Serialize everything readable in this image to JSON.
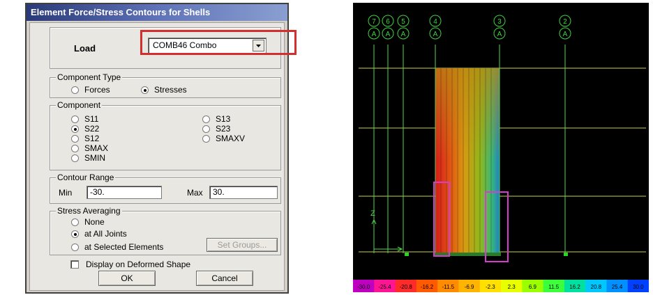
{
  "dialog": {
    "title": "Element Force/Stress Contours for Shells",
    "load": {
      "label": "Load",
      "value": "COMB46 Combo"
    },
    "component_type": {
      "label": "Component Type",
      "options": [
        "Forces",
        "Stresses"
      ],
      "selected": "Stresses"
    },
    "component": {
      "label": "Component",
      "left_options": [
        "S11",
        "S22",
        "S12",
        "SMAX",
        "SMIN"
      ],
      "right_options": [
        "S13",
        "S23",
        "SMAXV"
      ],
      "selected": "S22"
    },
    "contour_range": {
      "label": "Contour Range",
      "min_label": "Min",
      "min_value": "-30.",
      "max_label": "Max",
      "max_value": "30."
    },
    "stress_averaging": {
      "label": "Stress Averaging",
      "options": [
        "None",
        "at All Joints",
        "at Selected Elements"
      ],
      "selected": "at All Joints",
      "set_groups_label": "Set Groups..."
    },
    "display_deformed_label": "Display on Deformed Shape",
    "ok_label": "OK",
    "cancel_label": "Cancel"
  },
  "view": {
    "grid_bubbles": [
      {
        "top": "7",
        "bottom": "A"
      },
      {
        "top": "6",
        "bottom": "A"
      },
      {
        "top": "5",
        "bottom": "A"
      },
      {
        "top": "4",
        "bottom": "A"
      },
      {
        "top": "3",
        "bottom": "A"
      },
      {
        "top": "2",
        "bottom": "A"
      }
    ],
    "axis_label": "Z",
    "colors": {
      "grid_line": "#4fd84f",
      "level_line": "#c8d24a",
      "highlight": "#d83ccf",
      "bubble": "#3fd43f"
    }
  },
  "colorbar": {
    "ticks": [
      "-30.0",
      "-25.4",
      "-20.8",
      "-16.2",
      "-11.5",
      "-6.9",
      "-2.3",
      "2.3",
      "6.9",
      "11.5",
      "16.2",
      "20.8",
      "25.4",
      "30.0"
    ],
    "colors": [
      "#c000c0",
      "#ff1493",
      "#ff2a2a",
      "#ff5a00",
      "#ff8c00",
      "#ffb400",
      "#ffe000",
      "#e8ff00",
      "#9cff00",
      "#3cff3c",
      "#00e0a0",
      "#00c8ff",
      "#0090ff",
      "#0040ff"
    ]
  },
  "annotation": {
    "highlight_color": "#d32f2f"
  }
}
